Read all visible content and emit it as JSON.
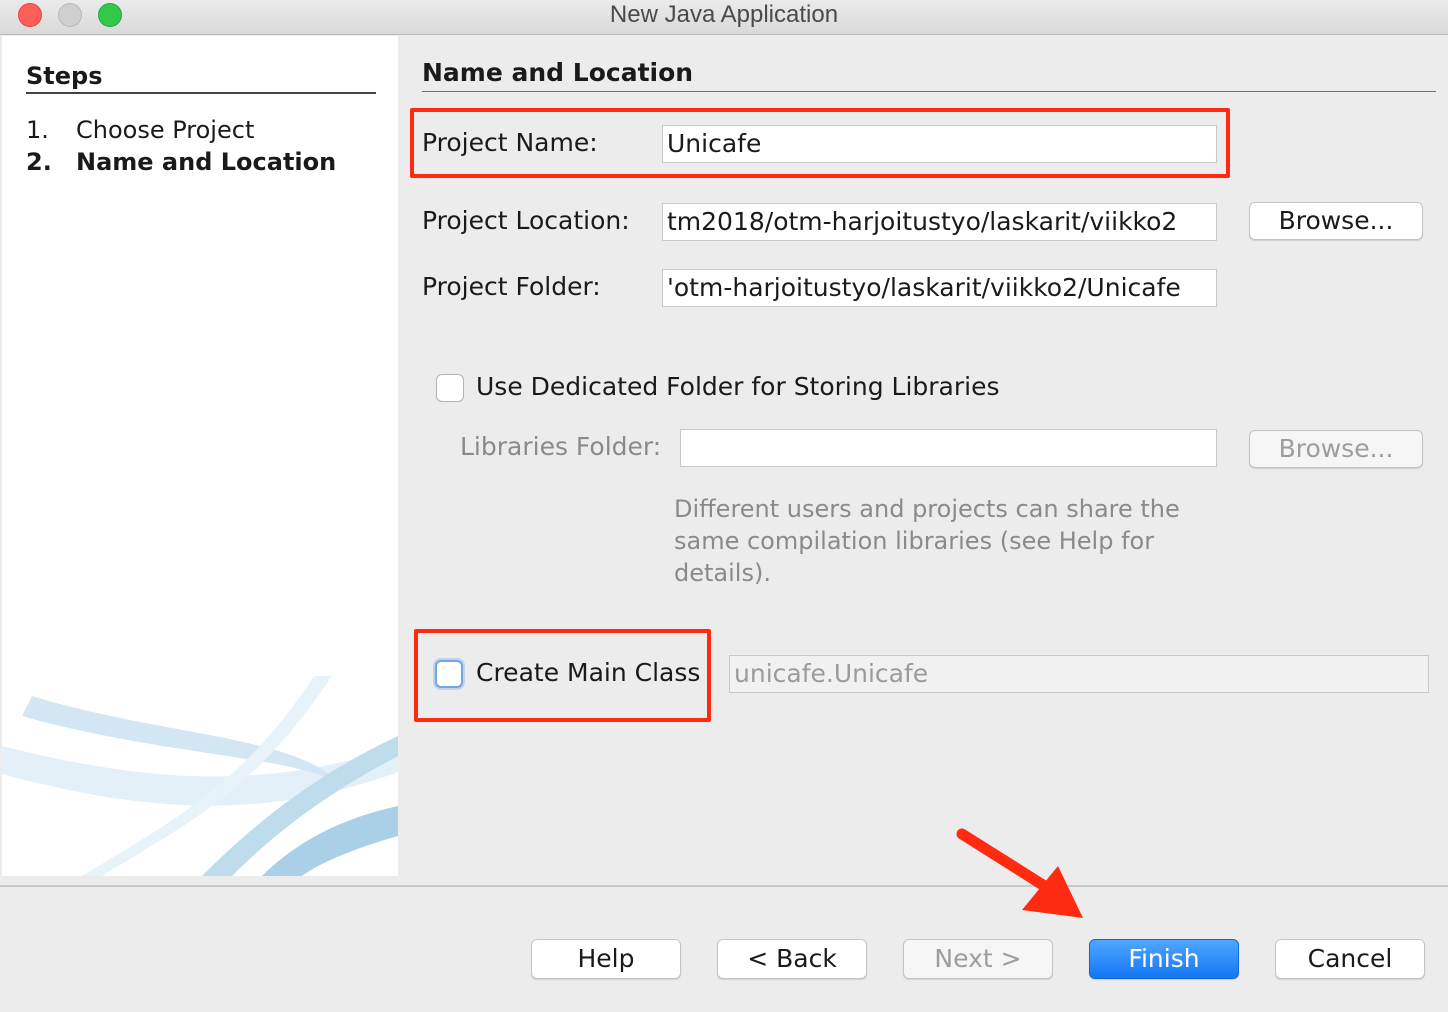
{
  "window": {
    "title": "New Java Application"
  },
  "steps": {
    "title": "Steps",
    "items": [
      {
        "number": "1.",
        "label": "Choose Project",
        "current": false
      },
      {
        "number": "2.",
        "label": "Name and Location",
        "current": true
      }
    ]
  },
  "section": {
    "title": "Name and Location"
  },
  "project_name": {
    "label": "Project Name:",
    "value": "Unicafe"
  },
  "project_location": {
    "label": "Project Location:",
    "value": "tm2018/otm-harjoitustyo/laskarit/viikko2",
    "browse_label": "Browse..."
  },
  "project_folder": {
    "label": "Project Folder:",
    "value": "'otm-harjoitustyo/laskarit/viikko2/Unicafe"
  },
  "libraries": {
    "checkbox_label": "Use Dedicated Folder for Storing Libraries",
    "checked": false,
    "folder_label": "Libraries Folder:",
    "folder_value": "",
    "browse_label": "Browse...",
    "help_lines": [
      "Different users and projects can share the",
      "same compilation libraries (see Help for",
      "details)."
    ]
  },
  "main_class": {
    "checkbox_label": "Create Main Class",
    "checked": false,
    "value": "unicafe.Unicafe"
  },
  "footer": {
    "help": "Help",
    "back": "< Back",
    "next": "Next >",
    "finish": "Finish",
    "cancel": "Cancel"
  },
  "colors": {
    "highlight": "#ff2a12",
    "primary_button": "#1576f4",
    "annotation_arrow": "#ff2a12"
  }
}
